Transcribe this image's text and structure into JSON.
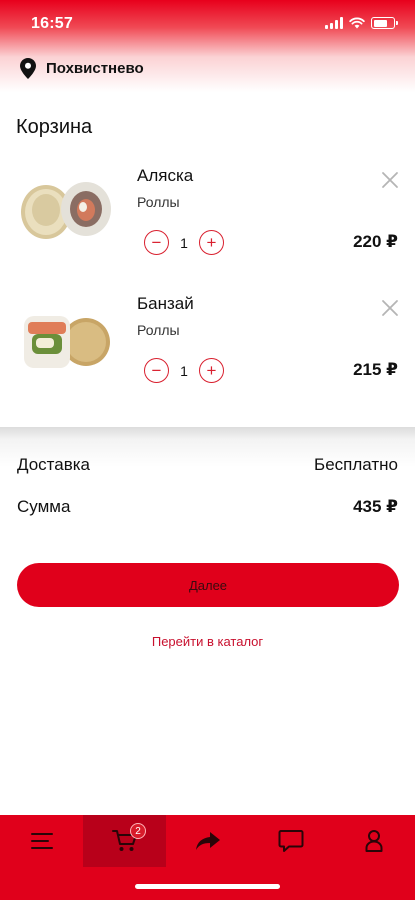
{
  "status_bar": {
    "time": "16:57"
  },
  "location": {
    "city": "Похвистнево",
    "icon": "location-pin-icon"
  },
  "page": {
    "title": "Корзина"
  },
  "cart_items": [
    {
      "name": "Аляска",
      "category": "Роллы",
      "quantity": "1",
      "price": "220 ₽",
      "image": "roll-sesame-image"
    },
    {
      "name": "Банзай",
      "category": "Роллы",
      "quantity": "1",
      "price": "215 ₽",
      "image": "roll-cucumber-image"
    }
  ],
  "summary": {
    "delivery_label": "Доставка",
    "delivery_value": "Бесплатно",
    "total_label": "Сумма",
    "total_value": "435 ₽"
  },
  "actions": {
    "next_label": "Далее",
    "catalog_link": "Перейти в каталог"
  },
  "tabbar": {
    "active": "cart",
    "cart_badge": "2",
    "items": [
      "menu-icon",
      "cart-icon",
      "share-icon",
      "chat-icon",
      "profile-icon"
    ]
  },
  "colors": {
    "accent": "#e0001b",
    "active_tab": "#b8001a",
    "link": "#c8102e"
  }
}
